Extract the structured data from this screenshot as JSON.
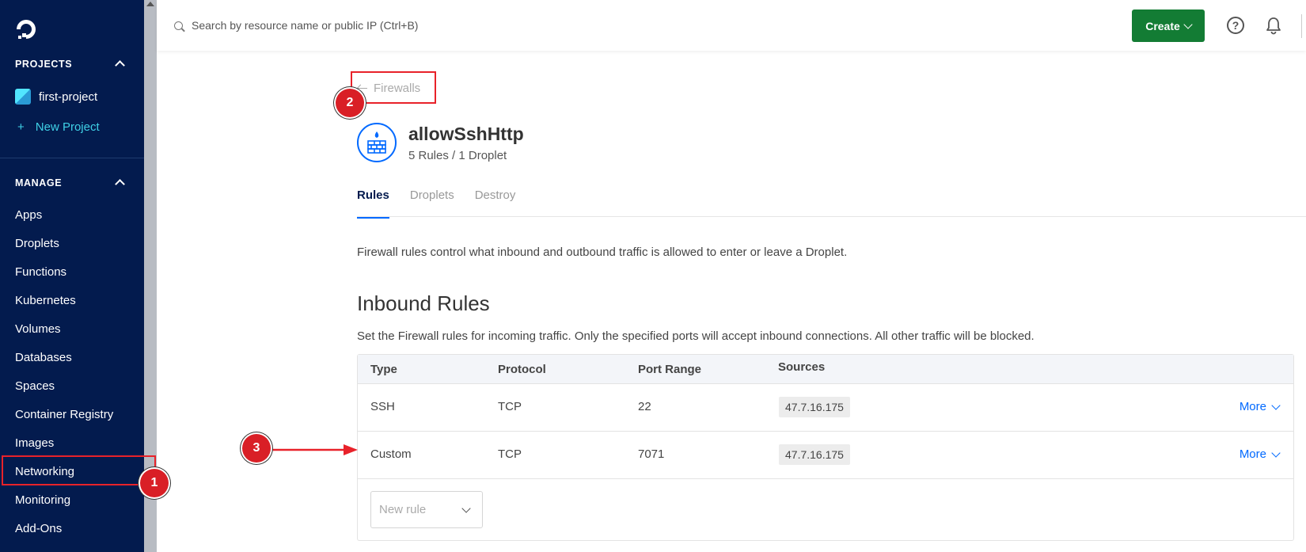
{
  "sidebar": {
    "projects_heading": "PROJECTS",
    "project_name": "first-project",
    "new_project": "New Project",
    "manage_heading": "MANAGE",
    "items": [
      {
        "label": "Apps"
      },
      {
        "label": "Droplets"
      },
      {
        "label": "Functions"
      },
      {
        "label": "Kubernetes"
      },
      {
        "label": "Volumes"
      },
      {
        "label": "Databases"
      },
      {
        "label": "Spaces"
      },
      {
        "label": "Container Registry"
      },
      {
        "label": "Images"
      },
      {
        "label": "Networking"
      },
      {
        "label": "Monitoring"
      },
      {
        "label": "Add-Ons"
      }
    ]
  },
  "topbar": {
    "search_placeholder": "Search by resource name or public IP (Ctrl+B)",
    "create_label": "Create",
    "help_label": "?"
  },
  "page": {
    "back_label": "Firewalls",
    "title": "allowSshHttp",
    "subtitle": "5 Rules / 1 Droplet",
    "tabs": [
      {
        "label": "Rules",
        "active": true
      },
      {
        "label": "Droplets",
        "active": false
      },
      {
        "label": "Destroy",
        "active": false
      }
    ],
    "description": "Firewall rules control what inbound and outbound traffic is allowed to enter or leave a Droplet.",
    "inbound_title": "Inbound Rules",
    "inbound_description": "Set the Firewall rules for incoming traffic. Only the specified ports will accept inbound connections. All other traffic will be blocked.",
    "table": {
      "headers": [
        "Type",
        "Protocol",
        "Port Range",
        "Sources"
      ],
      "rows": [
        {
          "type": "SSH",
          "protocol": "TCP",
          "port": "22",
          "source": "47.7.16.175",
          "more": "More"
        },
        {
          "type": "Custom",
          "protocol": "TCP",
          "port": "7071",
          "source": "47.7.16.175",
          "more": "More"
        }
      ],
      "new_rule_placeholder": "New rule"
    }
  },
  "annotations": {
    "badge1": "1",
    "badge2": "2",
    "badge3": "3",
    "color": "#e8222a"
  },
  "colors": {
    "sidebar_bg": "#031b4e",
    "accent": "#0069ff",
    "create_button": "#137c34"
  }
}
